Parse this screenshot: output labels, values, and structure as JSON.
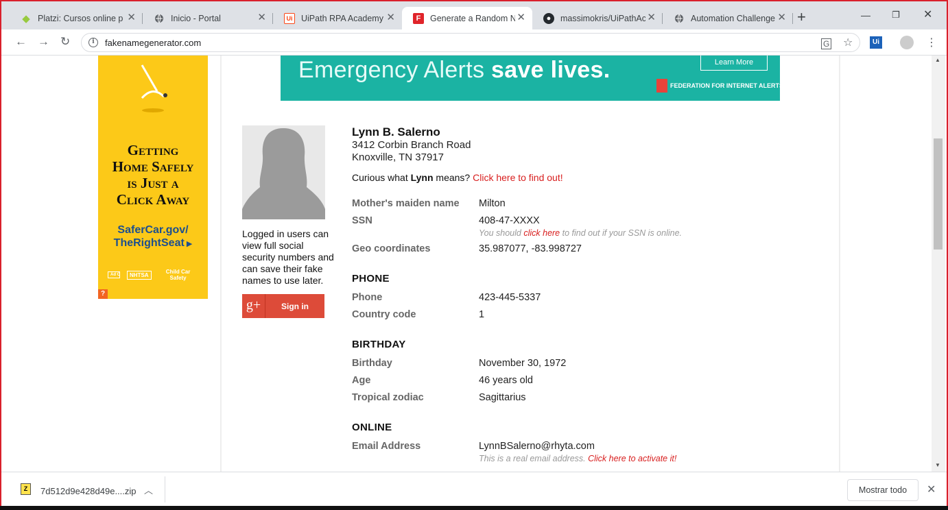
{
  "browser": {
    "tabs": [
      {
        "label": "Platzi: Cursos online pro",
        "icon": "platzi-icon",
        "color": "#98ca3f"
      },
      {
        "label": "Inicio - Portal",
        "icon": "globe-icon",
        "color": "#5f6368"
      },
      {
        "label": "UiPath RPA Academy",
        "icon": "uipath-icon",
        "color": "#fa4616"
      },
      {
        "label": "Generate a Random Name",
        "icon": "fng-icon",
        "color": "#e0242a"
      },
      {
        "label": "massimokris/UiPathAca",
        "icon": "github-icon",
        "color": "#24292e"
      },
      {
        "label": "Automation Challenge",
        "icon": "globe-icon",
        "color": "#5f6368"
      }
    ],
    "active_tab": 3,
    "url": "fakenamegenerator.com"
  },
  "side_ad": {
    "headline_lines": [
      "Getting",
      "Home Safely",
      "is Just a",
      "Click Away"
    ],
    "url_line1": "SaferCar.gov/",
    "url_line2": "TheRightSeat",
    "badges": [
      "Ad Council",
      "NHTSA",
      "Child Car Safety"
    ],
    "adchoice": "?"
  },
  "banner": {
    "text_light": "Emergency Alerts ",
    "text_bold": "save lives.",
    "button": "Learn More",
    "org": "FEDERATION FOR INTERNET ALERTS"
  },
  "sidebar": {
    "login_text": "Logged in users can view full social security numbers and can save their fake names to use later.",
    "signin_label": "Sign in",
    "gplus": "g+"
  },
  "person": {
    "name": "Lynn B. Salerno",
    "street": "3412 Corbin Branch Road",
    "city": "Knoxville, TN 37917",
    "curious_prefix": "Curious what ",
    "first_name": "Lynn",
    "curious_suffix": " means? ",
    "curious_link": "Click here to find out!",
    "fields": {
      "maiden_label": "Mother's maiden name",
      "maiden": "Milton",
      "ssn_label": "SSN",
      "ssn": "408-47-XXXX",
      "ssn_note_pre": "You should ",
      "ssn_note_link": "click here",
      "ssn_note_post": " to find out if your SSN is online.",
      "geo_label": "Geo coordinates",
      "geo": "35.987077, -83.998727"
    },
    "phone_section": "PHONE",
    "phone_label": "Phone",
    "phone": "423-445-5337",
    "country_code_label": "Country code",
    "country_code": "1",
    "birthday_section": "BIRTHDAY",
    "birthday_label": "Birthday",
    "birthday": "November 30, 1972",
    "age_label": "Age",
    "age": "46 years old",
    "zodiac_label": "Tropical zodiac",
    "zodiac": "Sagittarius",
    "online_section": "ONLINE",
    "email_label": "Email Address",
    "email": "LynnBSalerno@rhyta.com",
    "email_note_pre": "This is a real email address. ",
    "email_note_link": "Click here to activate it!"
  },
  "download": {
    "filename": "7d512d9e428d49e....zip",
    "show_all": "Mostrar todo"
  }
}
